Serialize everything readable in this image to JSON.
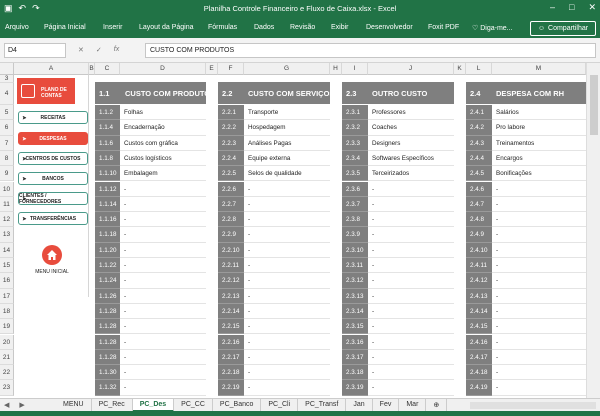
{
  "window": {
    "title": "Planilha Controle Financeiro e Fluxo de Caixa.xlsx - Excel"
  },
  "ribbon": {
    "tabs": [
      "Arquivo",
      "Página Inicial",
      "Inserir",
      "Layout da Página",
      "Fórmulas",
      "Dados",
      "Revisão",
      "Exibir",
      "Desenvolvedor",
      "Foxit PDF",
      "Diga-me..."
    ],
    "share": "Compartilhar"
  },
  "formula": {
    "namebox": "D4",
    "fx": "fx",
    "content": "CUSTO COM PRODUTOS"
  },
  "columns": [
    "A",
    "B",
    "C",
    "D",
    "E",
    "F",
    "G",
    "H",
    "I",
    "J",
    "K",
    "L",
    "M"
  ],
  "rows": [
    "3",
    "4",
    "5",
    "6",
    "7",
    "8",
    "9",
    "10",
    "11",
    "12",
    "13",
    "14",
    "15",
    "16",
    "17",
    "18",
    "19",
    "20",
    "21",
    "22",
    "23"
  ],
  "nav": {
    "logo": "PLANO DE CONTAS",
    "items": [
      "RECEITAS",
      "DESPESAS",
      "CENTROS DE CUSTOS",
      "BANCOS",
      "CLIENTES / FORNECEDORES",
      "TRANSFERÊNCIAS"
    ],
    "active_index": 1,
    "home_label": "MENU INICIAL"
  },
  "categories": [
    {
      "num": "1.1",
      "name": "CUSTO COM PRODUTOS",
      "codes": [
        "1.1.2",
        "1.1.4",
        "1.1.6",
        "1.1.8",
        "1.1.10",
        "1.1.12",
        "1.1.14",
        "1.1.16",
        "1.1.18",
        "1.1.20",
        "1.1.22",
        "1.1.24",
        "1.1.26",
        "1.1.28",
        "1.1.28",
        "1.1.28",
        "1.1.28",
        "1.1.30",
        "1.1.32"
      ],
      "values": [
        "Folhas",
        "Encadernação",
        "Custos com gráfica",
        "Custos logísticos",
        "Embalagem",
        "-",
        "-",
        "-",
        "-",
        "-",
        "-",
        "-",
        "-",
        "-",
        "-",
        "-",
        "-",
        "-",
        "-"
      ]
    },
    {
      "num": "2.2",
      "name": "CUSTO COM SERVIÇOS",
      "codes": [
        "2.2.1",
        "2.2.2",
        "2.2.3",
        "2.2.4",
        "2.2.5",
        "2.2.6",
        "2.2.7",
        "2.2.8",
        "2.2.9",
        "2.2.10",
        "2.2.11",
        "2.2.12",
        "2.2.13",
        "2.2.14",
        "2.2.15",
        "2.2.16",
        "2.2.17",
        "2.2.18",
        "2.2.19"
      ],
      "values": [
        "Transporte",
        "Hospedagem",
        "Análises Pagas",
        "Equipe externa",
        "Selos de qualidade",
        "-",
        "-",
        "-",
        "-",
        "-",
        "-",
        "-",
        "-",
        "-",
        "-",
        "-",
        "-",
        "-",
        "-"
      ]
    },
    {
      "num": "2.3",
      "name": "OUTRO CUSTO",
      "codes": [
        "2.3.1",
        "2.3.2",
        "2.3.3",
        "2.3.4",
        "2.3.5",
        "2.3.6",
        "2.3.7",
        "2.3.8",
        "2.3.9",
        "2.3.10",
        "2.3.11",
        "2.3.12",
        "2.3.13",
        "2.3.14",
        "2.3.15",
        "2.3.16",
        "2.3.17",
        "2.3.18",
        "2.3.19"
      ],
      "values": [
        "Professores",
        "Coaches",
        "Designers",
        "Softwares Específicos",
        "Terceirizados",
        "-",
        "-",
        "-",
        "-",
        "-",
        "-",
        "-",
        "-",
        "-",
        "-",
        "-",
        "-",
        "-",
        "-"
      ]
    },
    {
      "num": "2.4",
      "name": "DESPESA COM RH",
      "codes": [
        "2.4.1",
        "2.4.2",
        "2.4.3",
        "2.4.4",
        "2.4.5",
        "2.4.6",
        "2.4.7",
        "2.4.8",
        "2.4.9",
        "2.4.10",
        "2.4.11",
        "2.4.12",
        "2.4.13",
        "2.4.14",
        "2.4.15",
        "2.4.16",
        "2.4.17",
        "2.4.18",
        "2.4.19"
      ],
      "values": [
        "Salários",
        "Pro labore",
        "Treinamentos",
        "Encargos",
        "Bonificações",
        "-",
        "-",
        "-",
        "-",
        "-",
        "-",
        "-",
        "-",
        "-",
        "-",
        "-",
        "-",
        "-",
        "-"
      ]
    }
  ],
  "sheets": [
    "MENU",
    "PC_Rec",
    "PC_Des",
    "PC_CC",
    "PC_Banco",
    "PC_Cli",
    "PC_Transf",
    "Jan",
    "Fev",
    "Mar"
  ],
  "active_sheet": "PC_Des"
}
